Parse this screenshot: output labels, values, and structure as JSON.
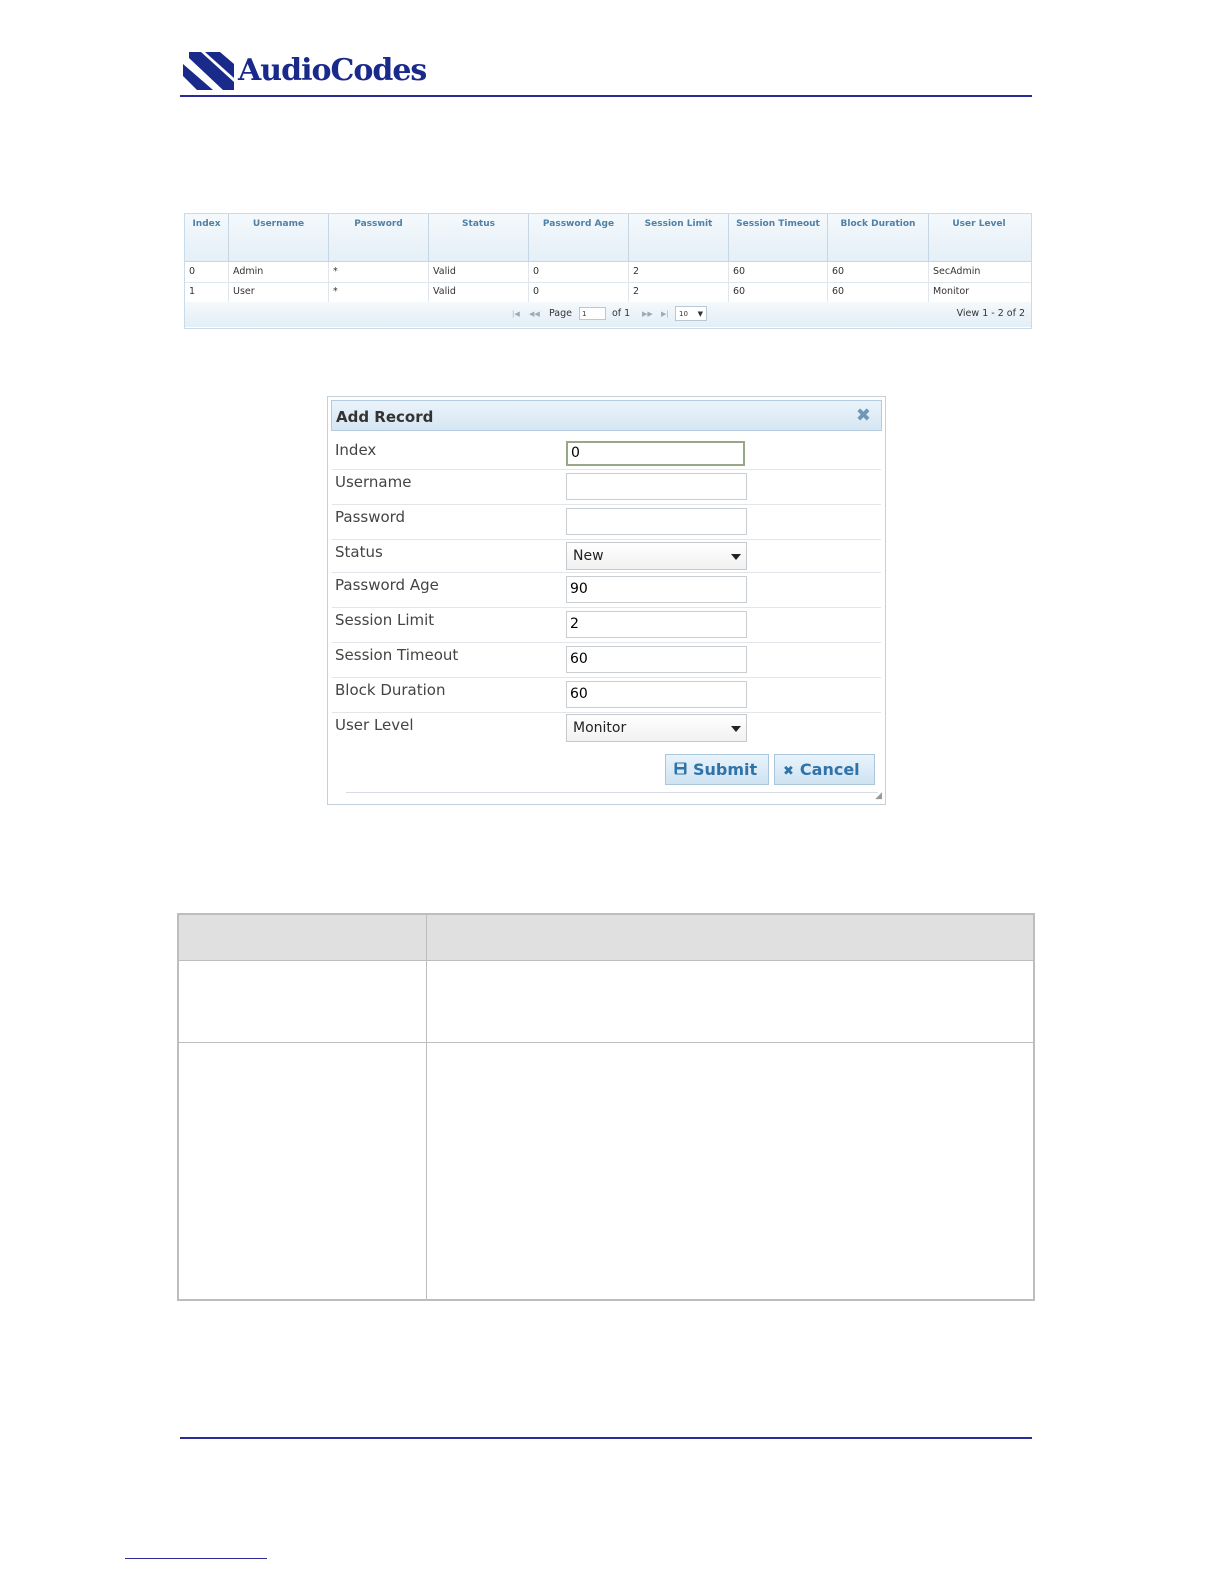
{
  "header": {
    "logo_text": "AudioCodes"
  },
  "users_table": {
    "columns": [
      "Index",
      "Username",
      "Password",
      "Status",
      "Password Age",
      "Session Limit",
      "Session Timeout",
      "Block Duration",
      "User Level"
    ],
    "rows": [
      [
        "0",
        "Admin",
        "*",
        "Valid",
        "0",
        "2",
        "60",
        "60",
        "SecAdmin"
      ],
      [
        "1",
        "User",
        "*",
        "Valid",
        "0",
        "2",
        "60",
        "60",
        "Monitor"
      ]
    ],
    "pager": {
      "page_label": "Page",
      "page_value": "1",
      "of_label": "of 1",
      "page_size": "10",
      "view_text": "View 1 - 2 of 2"
    }
  },
  "dialog": {
    "title": "Add Record",
    "fields": [
      {
        "label": "Index",
        "value": "0",
        "type": "input"
      },
      {
        "label": "Username",
        "value": "",
        "type": "input"
      },
      {
        "label": "Password",
        "value": "",
        "type": "input"
      },
      {
        "label": "Status",
        "value": "New",
        "type": "select"
      },
      {
        "label": "Password Age",
        "value": "90",
        "type": "input"
      },
      {
        "label": "Session Limit",
        "value": "2",
        "type": "input"
      },
      {
        "label": "Session Timeout",
        "value": "60",
        "type": "input"
      },
      {
        "label": "Block Duration",
        "value": "60",
        "type": "input"
      },
      {
        "label": "User Level",
        "value": "Monitor",
        "type": "select"
      }
    ],
    "submit_label": "Submit",
    "cancel_label": "Cancel"
  },
  "colors": {
    "brand": "#1a2a8a",
    "rule": "#2a2a9a",
    "header_text": "#4f81a6",
    "button_text": "#2f73a8"
  }
}
